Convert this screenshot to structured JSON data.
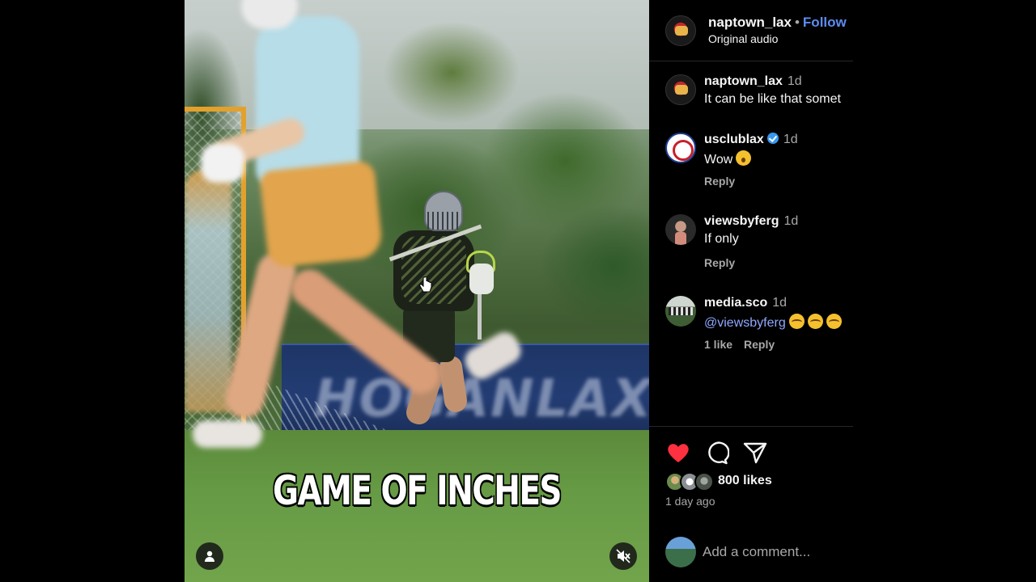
{
  "post": {
    "username": "naptown_lax",
    "follow_label": "Follow",
    "audio": "Original audio",
    "caption_overlay": "GAME OF INCHES",
    "banner_text": "HOGANLAX"
  },
  "comments": [
    {
      "user": "naptown_lax",
      "time": "1d",
      "text": "It can be like that somet",
      "verified": false
    },
    {
      "user": "usclublax",
      "time": "1d",
      "text": "Wow",
      "emoji": "astonished-face-emoji",
      "verified": true,
      "reply_label": "Reply"
    },
    {
      "user": "viewsbyferg",
      "time": "1d",
      "text": "If only",
      "verified": false,
      "reply_label": "Reply"
    },
    {
      "user": "media.sco",
      "time": "1d",
      "mention": "@viewsbyferg",
      "emoji": "flushed-face-emoji",
      "likes": "1 like",
      "verified": false,
      "reply_label": "Reply"
    }
  ],
  "footer": {
    "likes": "800 likes",
    "time": "1 day ago",
    "comment_placeholder": "Add a comment...",
    "like_color": "#ff3040"
  },
  "icons": {
    "like": "heart-icon",
    "comment": "comment-bubble-icon",
    "share": "paper-plane-icon",
    "tags": "person-icon",
    "mute": "speaker-muted-icon"
  },
  "colors": {
    "background": "#000000",
    "link": "#5c8cf0",
    "mention": "#8fa8ff",
    "secondary_text": "#a8a8a8",
    "verified": "#3897f0"
  }
}
